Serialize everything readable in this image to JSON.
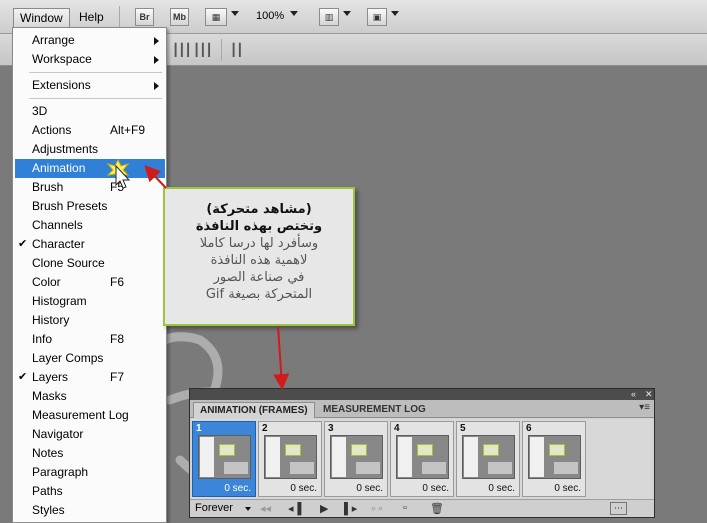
{
  "menubar": {
    "items": [
      "Window",
      "Help"
    ],
    "buttons": [
      "Br",
      "Mb"
    ],
    "zoom": "100%"
  },
  "dropdown": {
    "items": [
      {
        "label": "Arrange",
        "submenu": true
      },
      {
        "label": "Workspace",
        "submenu": true
      },
      {
        "sep": true
      },
      {
        "label": "Extensions",
        "submenu": true
      },
      {
        "sep": true
      },
      {
        "label": "3D"
      },
      {
        "label": "Actions",
        "shortcut": "Alt+F9"
      },
      {
        "label": "Adjustments"
      },
      {
        "label": "Animation",
        "highlighted": true
      },
      {
        "label": "Brush",
        "shortcut": "F5"
      },
      {
        "label": "Brush Presets"
      },
      {
        "label": "Channels"
      },
      {
        "label": "Character",
        "checked": true
      },
      {
        "label": "Clone Source"
      },
      {
        "label": "Color",
        "shortcut": "F6"
      },
      {
        "label": "Histogram"
      },
      {
        "label": "History"
      },
      {
        "label": "Info",
        "shortcut": "F8"
      },
      {
        "label": "Layer Comps"
      },
      {
        "label": "Layers",
        "shortcut": "F7",
        "checked": true
      },
      {
        "label": "Masks"
      },
      {
        "label": "Measurement Log"
      },
      {
        "label": "Navigator"
      },
      {
        "label": "Notes"
      },
      {
        "label": "Paragraph"
      },
      {
        "label": "Paths"
      },
      {
        "label": "Styles"
      }
    ]
  },
  "callout": {
    "lines": [
      "(مشاهد متحركة)",
      "وتختص بهذه النافذة",
      "وسأفرد لها درسا كاملا",
      "لاهمية هذه النافذة",
      "في صناعة الصور",
      "المتحركة بصيغة Gif"
    ]
  },
  "panel": {
    "tabs": [
      "ANIMATION (FRAMES)",
      "MEASUREMENT LOG"
    ],
    "frames": [
      {
        "num": "1",
        "delay": "0 sec."
      },
      {
        "num": "2",
        "delay": "0 sec."
      },
      {
        "num": "3",
        "delay": "0 sec."
      },
      {
        "num": "4",
        "delay": "0 sec."
      },
      {
        "num": "5",
        "delay": "0 sec."
      },
      {
        "num": "6",
        "delay": "0 sec."
      }
    ],
    "loop": "Forever"
  },
  "colors": {
    "highlight": "#2f80d6",
    "callout_border": "#9bc53d",
    "arrow": "#d11a1a"
  }
}
